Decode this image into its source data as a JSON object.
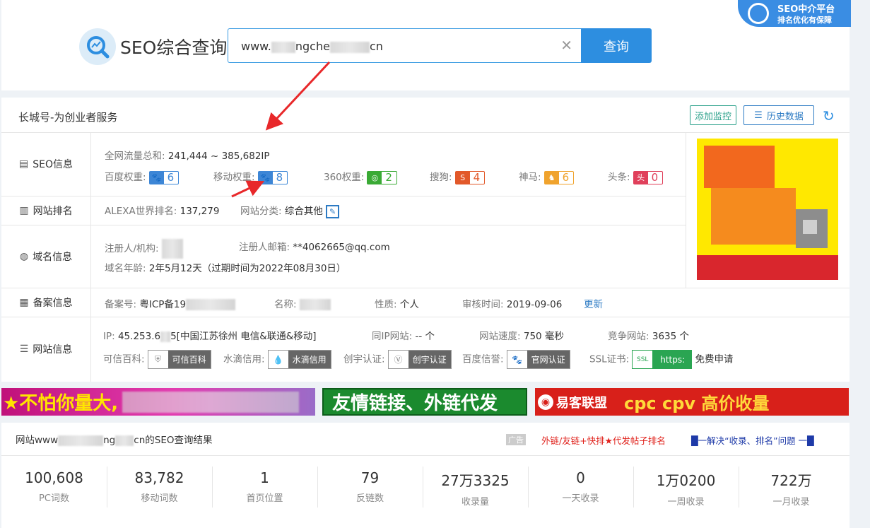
{
  "header": {
    "logo_text": "SEO综合查询",
    "search_value_prefix": "www.",
    "search_value_mid": "ngche",
    "search_value_suffix": "cn",
    "search_button": "查询",
    "badge_title": "SEO中介平台",
    "badge_subtitle": "排名优化有保障"
  },
  "site": {
    "title": "长城号-为创业者服务",
    "add_monitor": "添加监控",
    "history_data": "历史数据"
  },
  "rows": {
    "seo": {
      "label": "SEO信息",
      "traffic_label": "全网流量总和:",
      "traffic_value": "241,444 ~ 385,682IP",
      "weights": [
        {
          "label": "百度权重:",
          "value": "6",
          "color": "#3d86d6",
          "icon": "paw-icon"
        },
        {
          "label": "移动权重:",
          "value": "8",
          "color": "#3d86d6",
          "icon": "paw-icon"
        },
        {
          "label": "360权重:",
          "value": "2",
          "color": "#3aaa35",
          "icon": "360-icon"
        },
        {
          "label": "搜狗:",
          "value": "4",
          "color": "#e2592a",
          "icon": "sogou-icon"
        },
        {
          "label": "神马:",
          "value": "6",
          "color": "#f0a32d",
          "icon": "shenma-icon"
        },
        {
          "label": "头条:",
          "value": "0",
          "color": "#e0405b",
          "icon": "toutiao-icon"
        }
      ]
    },
    "rank": {
      "label": "网站排名",
      "alexa_label": "ALEXA世界排名:",
      "alexa_value": "137,279",
      "category_label": "网站分类:",
      "category_value": "综合其他"
    },
    "domain": {
      "label": "域名信息",
      "registrant_label": "注册人/机构:",
      "email_label": "注册人邮箱:",
      "email_value": "**4062665@qq.com",
      "age_label": "域名年龄:",
      "age_value": "2年5月12天（过期时间为2022年08月30日）"
    },
    "icp": {
      "label": "备案信息",
      "number_label": "备案号:",
      "number_value": "粤ICP备19",
      "name_label": "名称:",
      "nature_label": "性质:",
      "nature_value": "个人",
      "review_label": "审核时间:",
      "review_value": "2019-09-06",
      "update_link": "更新"
    },
    "web": {
      "label": "网站信息",
      "ip_label": "IP:",
      "ip_value_a": "45.253.6",
      "ip_value_b": "5[中国江苏徐州 电信&联通&移动]",
      "same_ip_label": "同IP网站:",
      "same_ip_value": "-- 个",
      "speed_label": "网站速度:",
      "speed_value": "750 毫秒",
      "compete_label": "竞争网站:",
      "compete_value": "3635 个",
      "trust_label": "可信百科:",
      "trust_badge": "可信百科",
      "shuidi_label": "水滴信用:",
      "shuidi_badge": "水滴信用",
      "chuangyu_label": "创宇认证:",
      "chuangyu_badge": "创宇认证",
      "baidu_label": "百度信誉:",
      "baidu_badge": "官网认证",
      "ssl_label": "SSL证书:",
      "ssl_badge": "https:",
      "ssl_free": "免费申请"
    }
  },
  "banners": {
    "b1": "★不怕你量大,",
    "b2": "友情链接、外链代发",
    "b3_brand": "易客联盟",
    "b3_text": "cpc cpv  高价收量"
  },
  "results": {
    "title_prefix": "网站www",
    "title_mid": "ng",
    "title_suffix": "cn的SEO查询结果",
    "ad_tag": "广告",
    "ad_link1": "外链/友链+快排★代发帖子排名",
    "ad_link2": "█一解决“收录、排名”问题 一█",
    "stats": [
      {
        "value": "100,608",
        "label": "PC词数"
      },
      {
        "value": "83,782",
        "label": "移动词数"
      },
      {
        "value": "1",
        "label": "首页位置"
      },
      {
        "value": "79",
        "label": "反链数"
      },
      {
        "value": "27万3325",
        "label": "收录量"
      },
      {
        "value": "0",
        "label": "一天收录"
      },
      {
        "value": "1万0200",
        "label": "一周收录"
      },
      {
        "value": "722万",
        "label": "一月收录"
      }
    ]
  }
}
